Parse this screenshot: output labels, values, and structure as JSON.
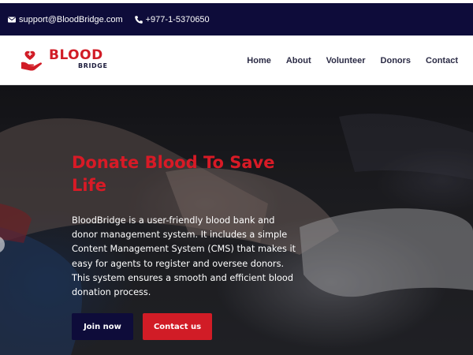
{
  "topbar": {
    "email": "support@BloodBridge.com",
    "phone": "+977-1-5370650",
    "email_icon": "envelope-icon",
    "phone_icon": "phone-icon"
  },
  "brand": {
    "name_main": "BLOOD",
    "name_sub": "BRIDGE",
    "logo_icon": "hand-heart-icon",
    "color_primary": "#d11c26",
    "color_dark": "#0e0c3a"
  },
  "nav": {
    "items": [
      {
        "label": "Home"
      },
      {
        "label": "About"
      },
      {
        "label": "Volunteer"
      },
      {
        "label": "Donors"
      },
      {
        "label": "Contact"
      }
    ]
  },
  "hero": {
    "title": "Donate Blood To Save Life",
    "description": "BloodBridge is a user-friendly blood bank and donor management system. It includes a simple Content Management System (CMS) that makes it easy for agents to register and oversee donors. This system ensures a smooth and efficient blood donation process.",
    "primary_button": "Join now",
    "secondary_button": "Contact us",
    "slider_icon": "chevron-left-icon"
  }
}
